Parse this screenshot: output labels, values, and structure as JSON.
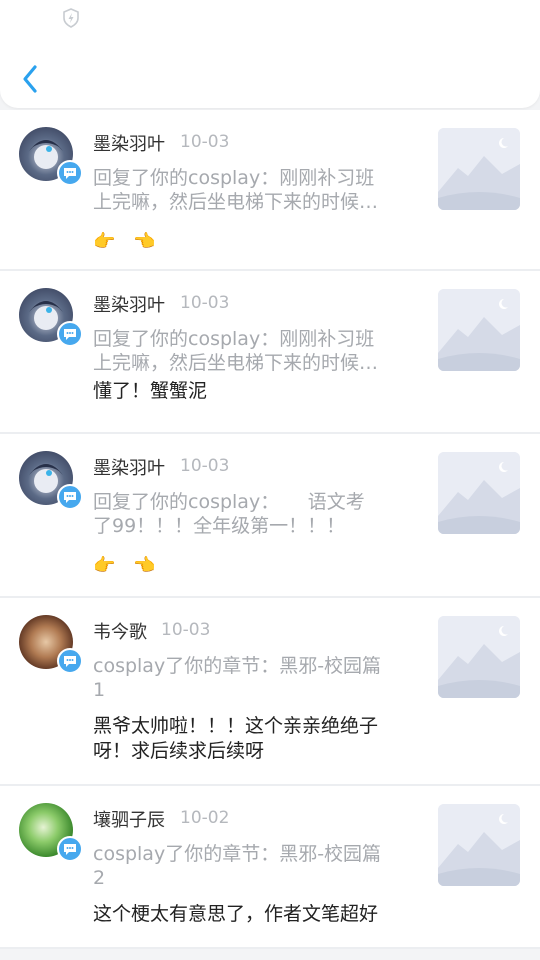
{
  "header": {
    "shield_icon": "shield-bolt-icon",
    "back_icon": "chevron-left-icon",
    "accent": "#2aa1ee"
  },
  "items": [
    {
      "name": "墨染羽叶",
      "date": "10-03",
      "reply_line1": "回复了你的cosplay：刚刚补习班",
      "reply_line2": "上完嘛，然后坐电梯下来的时候…",
      "comment_line1": "👉　👈",
      "comment_line2": ""
    },
    {
      "name": "墨染羽叶",
      "date": "10-03",
      "reply_line1": "回复了你的cosplay：刚刚补习班",
      "reply_line2": "上完嘛，然后坐电梯下来的时候…",
      "comment_line1": "懂了！蟹蟹泥",
      "comment_line2": ""
    },
    {
      "name": "墨染羽叶",
      "date": "10-03",
      "reply_line1": "回复了你的cosplay：　　语文考",
      "reply_line2": "了99！！！全年级第一！！！",
      "comment_line1": "👉　👈",
      "comment_line2": ""
    },
    {
      "name": "韦今歌",
      "date": "10-03",
      "reply_line1": "cosplay了你的章节：黑邪-校园篇",
      "reply_line2": "1",
      "comment_line1": "黑爷太帅啦！！！这个亲亲绝绝子",
      "comment_line2": "呀！求后续求后续呀"
    },
    {
      "name": "壤驷子辰",
      "date": "10-02",
      "reply_line1": "cosplay了你的章节：黑邪-校园篇",
      "reply_line2": "2",
      "comment_line1": "这个梗太有意思了，作者文笔超好",
      "comment_line2": ""
    }
  ],
  "icons": {
    "badge": "message-badge-icon",
    "thumb": "image-placeholder-icon"
  }
}
